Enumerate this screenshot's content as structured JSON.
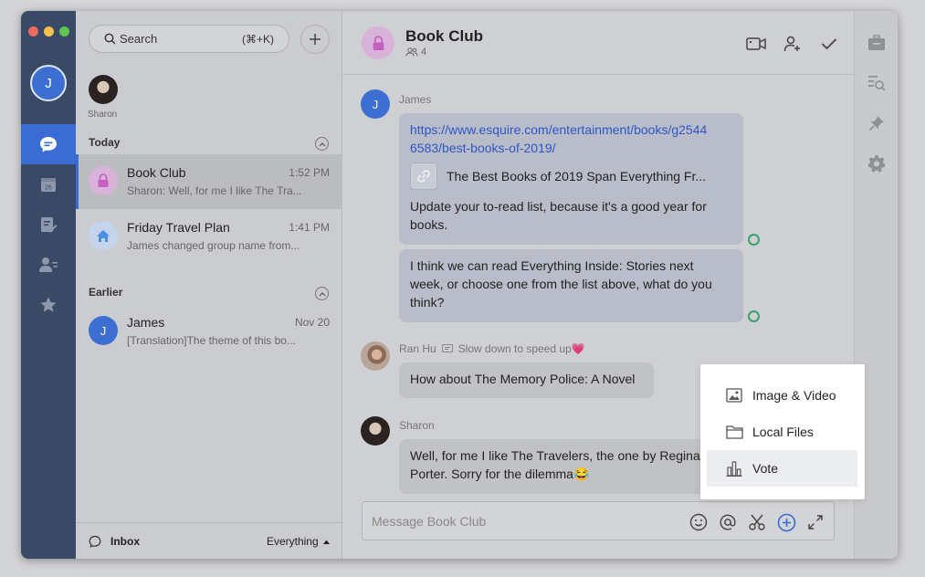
{
  "sidebar": {
    "avatar_initial": "J",
    "colors": {
      "rail": "#3a4a66",
      "active": "#3b6cd4"
    }
  },
  "conversation_list": {
    "search": {
      "label": "Search",
      "shortcut": "(⌘+K)"
    },
    "pinned": {
      "name": "Sharon"
    },
    "sections": {
      "today": "Today",
      "earlier": "Earlier"
    },
    "items": [
      {
        "title": "Book Club",
        "time": "1:52 PM",
        "preview": "Sharon: Well, for me I like The Tra...",
        "selected": true
      },
      {
        "title": "Friday Travel Plan",
        "time": "1:41 PM",
        "preview": "James changed group name from..."
      },
      {
        "title": "James",
        "time": "Nov 20",
        "preview": "[Translation]The theme of this bo...",
        "initial": "J"
      }
    ],
    "footer": {
      "inbox": "Inbox",
      "filter": "Everything"
    }
  },
  "chat": {
    "title": "Book Club",
    "member_count": "4",
    "messages": [
      {
        "sender": "James",
        "initial": "J",
        "link_url": "https://www.esquire.com/entertainment/books/g25446583/best-books-of-2019/",
        "link_url_line1": "https://www.esquire.com/entertainment/books/g2544",
        "link_url_line2": "6583/best-books-of-2019/",
        "link_title": "The Best Books of 2019 Span Everything Fr...",
        "link_desc_line1": "Update your to-read list, because it's a good year for",
        "link_desc_line2": "books."
      },
      {
        "text_line1": "I think we can read Everything Inside: Stories next",
        "text_line2": "week, or choose one from the list above, what do you",
        "text_line3": "think?"
      },
      {
        "sender": "Ran Hu",
        "status": "Slow down to speed up💗",
        "text": "How about The Memory Police: A Novel"
      },
      {
        "sender": "Sharon",
        "text_line1": "Well, for me I like The Travelers, the one by Regina",
        "text_line2": "Porter. Sorry for the dilemma😂"
      }
    ],
    "composer": {
      "placeholder": "Message Book Club"
    }
  },
  "attach_menu": {
    "items": [
      {
        "label": "Image & Video",
        "icon": "image-icon"
      },
      {
        "label": "Local Files",
        "icon": "folder-icon"
      },
      {
        "label": "Vote",
        "icon": "chart-icon",
        "hover": true
      }
    ]
  }
}
